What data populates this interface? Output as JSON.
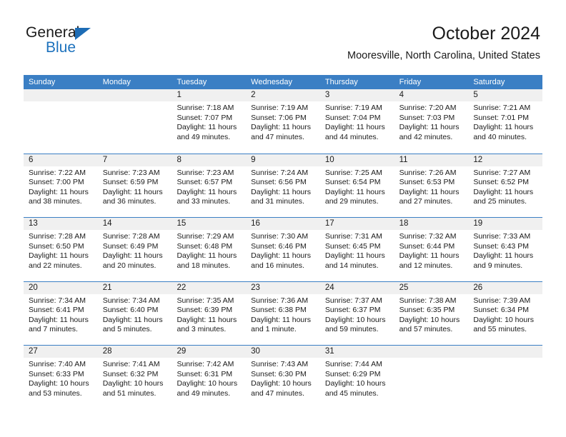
{
  "brand": {
    "name_top": "General",
    "name_bottom": "Blue",
    "accent_color": "#1d72bd",
    "triangle_color": "#1d6cb5"
  },
  "header": {
    "title": "October 2024",
    "location": "Mooresville, North Carolina, United States"
  },
  "calendar": {
    "header_bg": "#3b7fc4",
    "header_text_color": "#ffffff",
    "day_band_bg": "#f0f0f0",
    "weekdays": [
      "Sunday",
      "Monday",
      "Tuesday",
      "Wednesday",
      "Thursday",
      "Friday",
      "Saturday"
    ],
    "weeks": [
      [
        {
          "day": "",
          "sunrise": "",
          "sunset": "",
          "daylight_line1": "",
          "daylight_line2": ""
        },
        {
          "day": "",
          "sunrise": "",
          "sunset": "",
          "daylight_line1": "",
          "daylight_line2": ""
        },
        {
          "day": "1",
          "sunrise": "Sunrise: 7:18 AM",
          "sunset": "Sunset: 7:07 PM",
          "daylight_line1": "Daylight: 11 hours",
          "daylight_line2": "and 49 minutes."
        },
        {
          "day": "2",
          "sunrise": "Sunrise: 7:19 AM",
          "sunset": "Sunset: 7:06 PM",
          "daylight_line1": "Daylight: 11 hours",
          "daylight_line2": "and 47 minutes."
        },
        {
          "day": "3",
          "sunrise": "Sunrise: 7:19 AM",
          "sunset": "Sunset: 7:04 PM",
          "daylight_line1": "Daylight: 11 hours",
          "daylight_line2": "and 44 minutes."
        },
        {
          "day": "4",
          "sunrise": "Sunrise: 7:20 AM",
          "sunset": "Sunset: 7:03 PM",
          "daylight_line1": "Daylight: 11 hours",
          "daylight_line2": "and 42 minutes."
        },
        {
          "day": "5",
          "sunrise": "Sunrise: 7:21 AM",
          "sunset": "Sunset: 7:01 PM",
          "daylight_line1": "Daylight: 11 hours",
          "daylight_line2": "and 40 minutes."
        }
      ],
      [
        {
          "day": "6",
          "sunrise": "Sunrise: 7:22 AM",
          "sunset": "Sunset: 7:00 PM",
          "daylight_line1": "Daylight: 11 hours",
          "daylight_line2": "and 38 minutes."
        },
        {
          "day": "7",
          "sunrise": "Sunrise: 7:23 AM",
          "sunset": "Sunset: 6:59 PM",
          "daylight_line1": "Daylight: 11 hours",
          "daylight_line2": "and 36 minutes."
        },
        {
          "day": "8",
          "sunrise": "Sunrise: 7:23 AM",
          "sunset": "Sunset: 6:57 PM",
          "daylight_line1": "Daylight: 11 hours",
          "daylight_line2": "and 33 minutes."
        },
        {
          "day": "9",
          "sunrise": "Sunrise: 7:24 AM",
          "sunset": "Sunset: 6:56 PM",
          "daylight_line1": "Daylight: 11 hours",
          "daylight_line2": "and 31 minutes."
        },
        {
          "day": "10",
          "sunrise": "Sunrise: 7:25 AM",
          "sunset": "Sunset: 6:54 PM",
          "daylight_line1": "Daylight: 11 hours",
          "daylight_line2": "and 29 minutes."
        },
        {
          "day": "11",
          "sunrise": "Sunrise: 7:26 AM",
          "sunset": "Sunset: 6:53 PM",
          "daylight_line1": "Daylight: 11 hours",
          "daylight_line2": "and 27 minutes."
        },
        {
          "day": "12",
          "sunrise": "Sunrise: 7:27 AM",
          "sunset": "Sunset: 6:52 PM",
          "daylight_line1": "Daylight: 11 hours",
          "daylight_line2": "and 25 minutes."
        }
      ],
      [
        {
          "day": "13",
          "sunrise": "Sunrise: 7:28 AM",
          "sunset": "Sunset: 6:50 PM",
          "daylight_line1": "Daylight: 11 hours",
          "daylight_line2": "and 22 minutes."
        },
        {
          "day": "14",
          "sunrise": "Sunrise: 7:28 AM",
          "sunset": "Sunset: 6:49 PM",
          "daylight_line1": "Daylight: 11 hours",
          "daylight_line2": "and 20 minutes."
        },
        {
          "day": "15",
          "sunrise": "Sunrise: 7:29 AM",
          "sunset": "Sunset: 6:48 PM",
          "daylight_line1": "Daylight: 11 hours",
          "daylight_line2": "and 18 minutes."
        },
        {
          "day": "16",
          "sunrise": "Sunrise: 7:30 AM",
          "sunset": "Sunset: 6:46 PM",
          "daylight_line1": "Daylight: 11 hours",
          "daylight_line2": "and 16 minutes."
        },
        {
          "day": "17",
          "sunrise": "Sunrise: 7:31 AM",
          "sunset": "Sunset: 6:45 PM",
          "daylight_line1": "Daylight: 11 hours",
          "daylight_line2": "and 14 minutes."
        },
        {
          "day": "18",
          "sunrise": "Sunrise: 7:32 AM",
          "sunset": "Sunset: 6:44 PM",
          "daylight_line1": "Daylight: 11 hours",
          "daylight_line2": "and 12 minutes."
        },
        {
          "day": "19",
          "sunrise": "Sunrise: 7:33 AM",
          "sunset": "Sunset: 6:43 PM",
          "daylight_line1": "Daylight: 11 hours",
          "daylight_line2": "and 9 minutes."
        }
      ],
      [
        {
          "day": "20",
          "sunrise": "Sunrise: 7:34 AM",
          "sunset": "Sunset: 6:41 PM",
          "daylight_line1": "Daylight: 11 hours",
          "daylight_line2": "and 7 minutes."
        },
        {
          "day": "21",
          "sunrise": "Sunrise: 7:34 AM",
          "sunset": "Sunset: 6:40 PM",
          "daylight_line1": "Daylight: 11 hours",
          "daylight_line2": "and 5 minutes."
        },
        {
          "day": "22",
          "sunrise": "Sunrise: 7:35 AM",
          "sunset": "Sunset: 6:39 PM",
          "daylight_line1": "Daylight: 11 hours",
          "daylight_line2": "and 3 minutes."
        },
        {
          "day": "23",
          "sunrise": "Sunrise: 7:36 AM",
          "sunset": "Sunset: 6:38 PM",
          "daylight_line1": "Daylight: 11 hours",
          "daylight_line2": "and 1 minute."
        },
        {
          "day": "24",
          "sunrise": "Sunrise: 7:37 AM",
          "sunset": "Sunset: 6:37 PM",
          "daylight_line1": "Daylight: 10 hours",
          "daylight_line2": "and 59 minutes."
        },
        {
          "day": "25",
          "sunrise": "Sunrise: 7:38 AM",
          "sunset": "Sunset: 6:35 PM",
          "daylight_line1": "Daylight: 10 hours",
          "daylight_line2": "and 57 minutes."
        },
        {
          "day": "26",
          "sunrise": "Sunrise: 7:39 AM",
          "sunset": "Sunset: 6:34 PM",
          "daylight_line1": "Daylight: 10 hours",
          "daylight_line2": "and 55 minutes."
        }
      ],
      [
        {
          "day": "27",
          "sunrise": "Sunrise: 7:40 AM",
          "sunset": "Sunset: 6:33 PM",
          "daylight_line1": "Daylight: 10 hours",
          "daylight_line2": "and 53 minutes."
        },
        {
          "day": "28",
          "sunrise": "Sunrise: 7:41 AM",
          "sunset": "Sunset: 6:32 PM",
          "daylight_line1": "Daylight: 10 hours",
          "daylight_line2": "and 51 minutes."
        },
        {
          "day": "29",
          "sunrise": "Sunrise: 7:42 AM",
          "sunset": "Sunset: 6:31 PM",
          "daylight_line1": "Daylight: 10 hours",
          "daylight_line2": "and 49 minutes."
        },
        {
          "day": "30",
          "sunrise": "Sunrise: 7:43 AM",
          "sunset": "Sunset: 6:30 PM",
          "daylight_line1": "Daylight: 10 hours",
          "daylight_line2": "and 47 minutes."
        },
        {
          "day": "31",
          "sunrise": "Sunrise: 7:44 AM",
          "sunset": "Sunset: 6:29 PM",
          "daylight_line1": "Daylight: 10 hours",
          "daylight_line2": "and 45 minutes."
        },
        {
          "day": "",
          "sunrise": "",
          "sunset": "",
          "daylight_line1": "",
          "daylight_line2": ""
        },
        {
          "day": "",
          "sunrise": "",
          "sunset": "",
          "daylight_line1": "",
          "daylight_line2": ""
        }
      ]
    ]
  }
}
